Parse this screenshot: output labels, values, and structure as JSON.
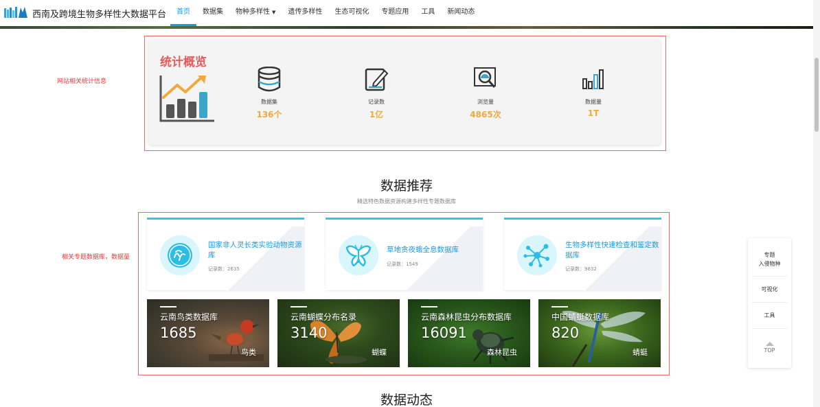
{
  "header": {
    "site_title": "西南及跨境生物多样性大数据平台",
    "menu": [
      {
        "label": "首页",
        "active": true
      },
      {
        "label": "数据集"
      },
      {
        "label": "物种多样性",
        "has_caret": true
      },
      {
        "label": "遗传多样性"
      },
      {
        "label": "生态可视化"
      },
      {
        "label": "专题应用"
      },
      {
        "label": "工具"
      },
      {
        "label": "新闻动态"
      }
    ]
  },
  "annotations": {
    "stats_note": "网站相关统计信息",
    "db_note": "相关专题数据库，数据量"
  },
  "stats": {
    "title": "统计概览",
    "items": [
      {
        "label": "数据集",
        "value": "136个",
        "icon": "database-icon"
      },
      {
        "label": "记录数",
        "value": "1亿",
        "icon": "edit-icon"
      },
      {
        "label": "浏览量",
        "value": "4865次",
        "icon": "monitor-search-icon"
      },
      {
        "label": "数据量",
        "value": "1T",
        "icon": "bar-chart-icon"
      }
    ]
  },
  "recommend": {
    "title": "数据推荐",
    "subtitle": "精选特色数据资源构建多样性专题数据库",
    "db_cards": [
      {
        "name": "国家非人灵长类实验动物资源库",
        "count": "记录数：2635",
        "icon": "cells-icon"
      },
      {
        "name": "草地贪夜蛾全息数据库",
        "count": "记录数：1549",
        "icon": "moth-icon"
      },
      {
        "name": "生物多样性快速检查和鉴定数据库",
        "count": "记录数：9832",
        "icon": "network-icon"
      }
    ],
    "image_cards": [
      {
        "name": "云南鸟类数据库",
        "count": "1685",
        "category": "鸟类",
        "theme": "bird"
      },
      {
        "name": "云南蝴蝶分布名录",
        "count": "3140",
        "category": "蝴蝶",
        "theme": "butterfly"
      },
      {
        "name": "云南森林昆虫分布数据库",
        "count": "16091",
        "category": "森林昆虫",
        "theme": "beetle"
      },
      {
        "name": "中国蜻蜓数据库",
        "count": "820",
        "category": "蜻蜓",
        "theme": "dragonfly"
      }
    ]
  },
  "news": {
    "title": "数据动态"
  },
  "side_widget": {
    "items": [
      "专题\n入侵物种",
      "可视化",
      "工具"
    ],
    "top_label": "TOP"
  },
  "colors": {
    "accent": "#1c9bd8",
    "stat_value": "#f0a93a",
    "stats_title": "#e35c5c",
    "card_top": "#2dc8ea"
  }
}
